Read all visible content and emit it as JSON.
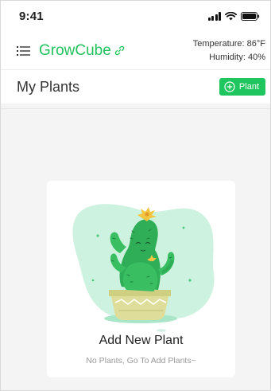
{
  "status_bar": {
    "time": "9:41"
  },
  "header": {
    "app_name": "GrowCube",
    "temperature": "Temperature: 86°F",
    "humidity": "Humidity: 40%"
  },
  "toolbar": {
    "title": "My Plants",
    "add_button_label": "Plant"
  },
  "empty_state": {
    "title": "Add New Plant",
    "subtitle": "No Plants, Go To Add Plants~"
  },
  "colors": {
    "brand": "#21c25e",
    "button": "#1fc55e"
  }
}
